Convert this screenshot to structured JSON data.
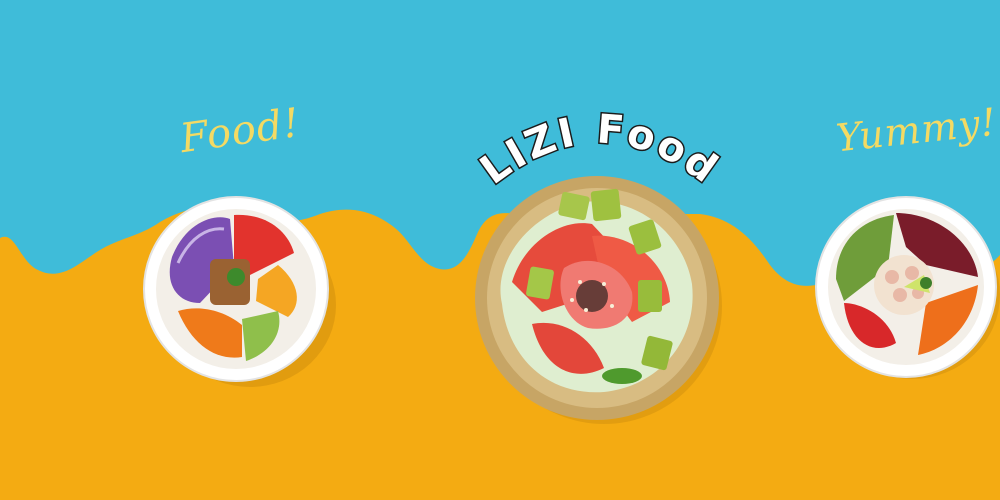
{
  "banner": {
    "title": "LIZI Food",
    "label_left": "Food!",
    "label_right": "Yummy!",
    "colors": {
      "sky": "#3fbcd9",
      "yellow": "#f4ab12",
      "label_yellow": "#f4da63",
      "title_white": "#ffffff",
      "title_outline": "#1b1b1b",
      "bowl_white": "#ffffff",
      "bowl_gold": "#c7a565"
    }
  }
}
